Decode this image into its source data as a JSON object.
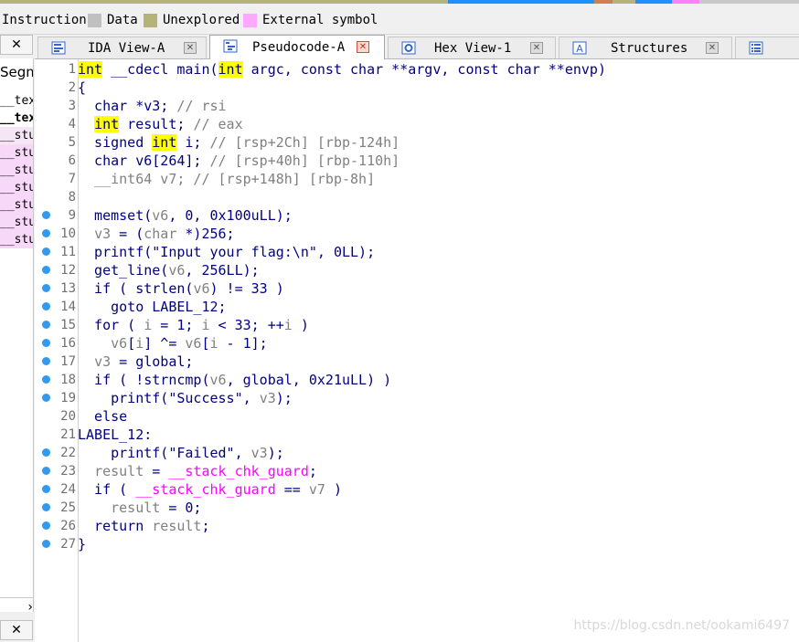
{
  "legend": {
    "items": [
      {
        "label": "Instruction",
        "color": "#c0c0c0"
      },
      {
        "label": "Data",
        "color": "#c0c0c0"
      },
      {
        "label": "Unexplored",
        "color": "#b4b47a"
      },
      {
        "label": "External symbol",
        "color": "#ffa8ff"
      }
    ]
  },
  "left_panel": {
    "close_glyph": "✕",
    "header": "Segm",
    "rows": [
      "__tex",
      "__tex",
      "__stu",
      "__stu",
      "__stu",
      "__stu",
      "__stu",
      "__stu",
      "__stu"
    ],
    "scroll_glyph": "›"
  },
  "tabs": [
    {
      "label": "IDA View-A",
      "icon": "ida-view-icon",
      "active": false
    },
    {
      "label": "Pseudocode-A",
      "icon": "pseudocode-icon",
      "active": true
    },
    {
      "label": "Hex View-1",
      "icon": "hex-view-icon",
      "active": false
    },
    {
      "label": "Structures",
      "icon": "structures-icon",
      "active": false
    },
    {
      "label": "",
      "icon": "enums-icon",
      "active": false
    }
  ],
  "tab_close_glyph": "✕",
  "code": {
    "lines": [
      {
        "n": "1",
        "dot": false,
        "segs": [
          [
            "kw",
            "int"
          ],
          [
            "t",
            " __cdecl main("
          ],
          [
            "kw",
            "int"
          ],
          [
            "t",
            " argc, const char **argv, const char **envp)"
          ]
        ]
      },
      {
        "n": "2",
        "dot": false,
        "segs": [
          [
            "t",
            "{"
          ]
        ]
      },
      {
        "n": "3",
        "dot": false,
        "segs": [
          [
            "t",
            "  char *v3; "
          ],
          [
            "cm",
            "// rsi"
          ]
        ]
      },
      {
        "n": "4",
        "dot": false,
        "segs": [
          [
            "t",
            "  "
          ],
          [
            "kw",
            "int"
          ],
          [
            "t",
            " result; "
          ],
          [
            "cm",
            "// eax"
          ]
        ]
      },
      {
        "n": "5",
        "dot": false,
        "segs": [
          [
            "t",
            "  signed "
          ],
          [
            "kw",
            "int"
          ],
          [
            "t",
            " i; "
          ],
          [
            "cm",
            "// [rsp+2Ch] [rbp-124h]"
          ]
        ]
      },
      {
        "n": "6",
        "dot": false,
        "segs": [
          [
            "t",
            "  char v6[264]; "
          ],
          [
            "cm",
            "// [rsp+40h] [rbp-110h]"
          ]
        ]
      },
      {
        "n": "7",
        "dot": false,
        "segs": [
          [
            "cm",
            "  __int64 v7; // [rsp+148h] [rbp-8h]"
          ]
        ]
      },
      {
        "n": "8",
        "dot": false,
        "segs": [
          [
            "t",
            ""
          ]
        ]
      },
      {
        "n": "9",
        "dot": true,
        "segs": [
          [
            "t",
            "  memset("
          ],
          [
            "va",
            "v6"
          ],
          [
            "t",
            ", 0, 0x100uLL);"
          ]
        ]
      },
      {
        "n": "10",
        "dot": true,
        "segs": [
          [
            "t",
            "  "
          ],
          [
            "va",
            "v3"
          ],
          [
            "t",
            " = ("
          ],
          [
            "va",
            "char"
          ],
          [
            "t",
            " *)256;"
          ]
        ]
      },
      {
        "n": "11",
        "dot": true,
        "segs": [
          [
            "t",
            "  printf(\"Input your flag:\\n\", 0LL);"
          ]
        ]
      },
      {
        "n": "12",
        "dot": true,
        "segs": [
          [
            "t",
            "  get_line("
          ],
          [
            "va",
            "v6"
          ],
          [
            "t",
            ", 256LL);"
          ]
        ]
      },
      {
        "n": "13",
        "dot": true,
        "segs": [
          [
            "t",
            "  if ( strlen("
          ],
          [
            "va",
            "v6"
          ],
          [
            "t",
            ") != 33 )"
          ]
        ]
      },
      {
        "n": "14",
        "dot": true,
        "segs": [
          [
            "t",
            "    goto LABEL_12;"
          ]
        ]
      },
      {
        "n": "15",
        "dot": true,
        "segs": [
          [
            "t",
            "  for ( "
          ],
          [
            "va",
            "i"
          ],
          [
            "t",
            " = 1; "
          ],
          [
            "va",
            "i"
          ],
          [
            "t",
            " < 33; ++"
          ],
          [
            "va",
            "i"
          ],
          [
            "t",
            " )"
          ]
        ]
      },
      {
        "n": "16",
        "dot": true,
        "segs": [
          [
            "t",
            "    "
          ],
          [
            "va",
            "v6"
          ],
          [
            "t",
            "["
          ],
          [
            "va",
            "i"
          ],
          [
            "t",
            "] ^= "
          ],
          [
            "va",
            "v6"
          ],
          [
            "t",
            "["
          ],
          [
            "va",
            "i"
          ],
          [
            "t",
            " - 1];"
          ]
        ]
      },
      {
        "n": "17",
        "dot": true,
        "segs": [
          [
            "t",
            "  "
          ],
          [
            "va",
            "v3"
          ],
          [
            "t",
            " = global;"
          ]
        ]
      },
      {
        "n": "18",
        "dot": true,
        "segs": [
          [
            "t",
            "  if ( !strncmp("
          ],
          [
            "va",
            "v6"
          ],
          [
            "t",
            ", global, 0x21uLL) )"
          ]
        ]
      },
      {
        "n": "19",
        "dot": true,
        "segs": [
          [
            "t",
            "    printf(\"Success\", "
          ],
          [
            "va",
            "v3"
          ],
          [
            "t",
            ");"
          ]
        ]
      },
      {
        "n": "20",
        "dot": false,
        "segs": [
          [
            "t",
            "  else"
          ]
        ]
      },
      {
        "n": "21",
        "dot": false,
        "segs": [
          [
            "t",
            "LABEL_12:"
          ]
        ]
      },
      {
        "n": "22",
        "dot": true,
        "segs": [
          [
            "t",
            "    printf(\"Failed\", "
          ],
          [
            "va",
            "v3"
          ],
          [
            "t",
            ");"
          ]
        ]
      },
      {
        "n": "23",
        "dot": true,
        "segs": [
          [
            "t",
            "  "
          ],
          [
            "va",
            "result"
          ],
          [
            "t",
            " = "
          ],
          [
            "im",
            "__stack_chk_guard"
          ],
          [
            "t",
            ";"
          ]
        ]
      },
      {
        "n": "24",
        "dot": true,
        "segs": [
          [
            "t",
            "  if ( "
          ],
          [
            "im",
            "__stack_chk_guard"
          ],
          [
            "t",
            " == "
          ],
          [
            "va",
            "v7"
          ],
          [
            "t",
            " )"
          ]
        ]
      },
      {
        "n": "25",
        "dot": true,
        "segs": [
          [
            "t",
            "    "
          ],
          [
            "va",
            "result"
          ],
          [
            "t",
            " = 0;"
          ]
        ]
      },
      {
        "n": "26",
        "dot": true,
        "segs": [
          [
            "t",
            "  return "
          ],
          [
            "va",
            "result"
          ],
          [
            "t",
            ";"
          ]
        ]
      },
      {
        "n": "27",
        "dot": true,
        "segs": [
          [
            "t",
            "}"
          ]
        ]
      }
    ]
  },
  "watermark": "https://blog.csdn.net/ookami6497",
  "colors": {
    "highlight": "#ffff00",
    "code": "#000080",
    "comment": "#808080",
    "import": "#ff00ff",
    "breakpoint": "#3399ee"
  }
}
